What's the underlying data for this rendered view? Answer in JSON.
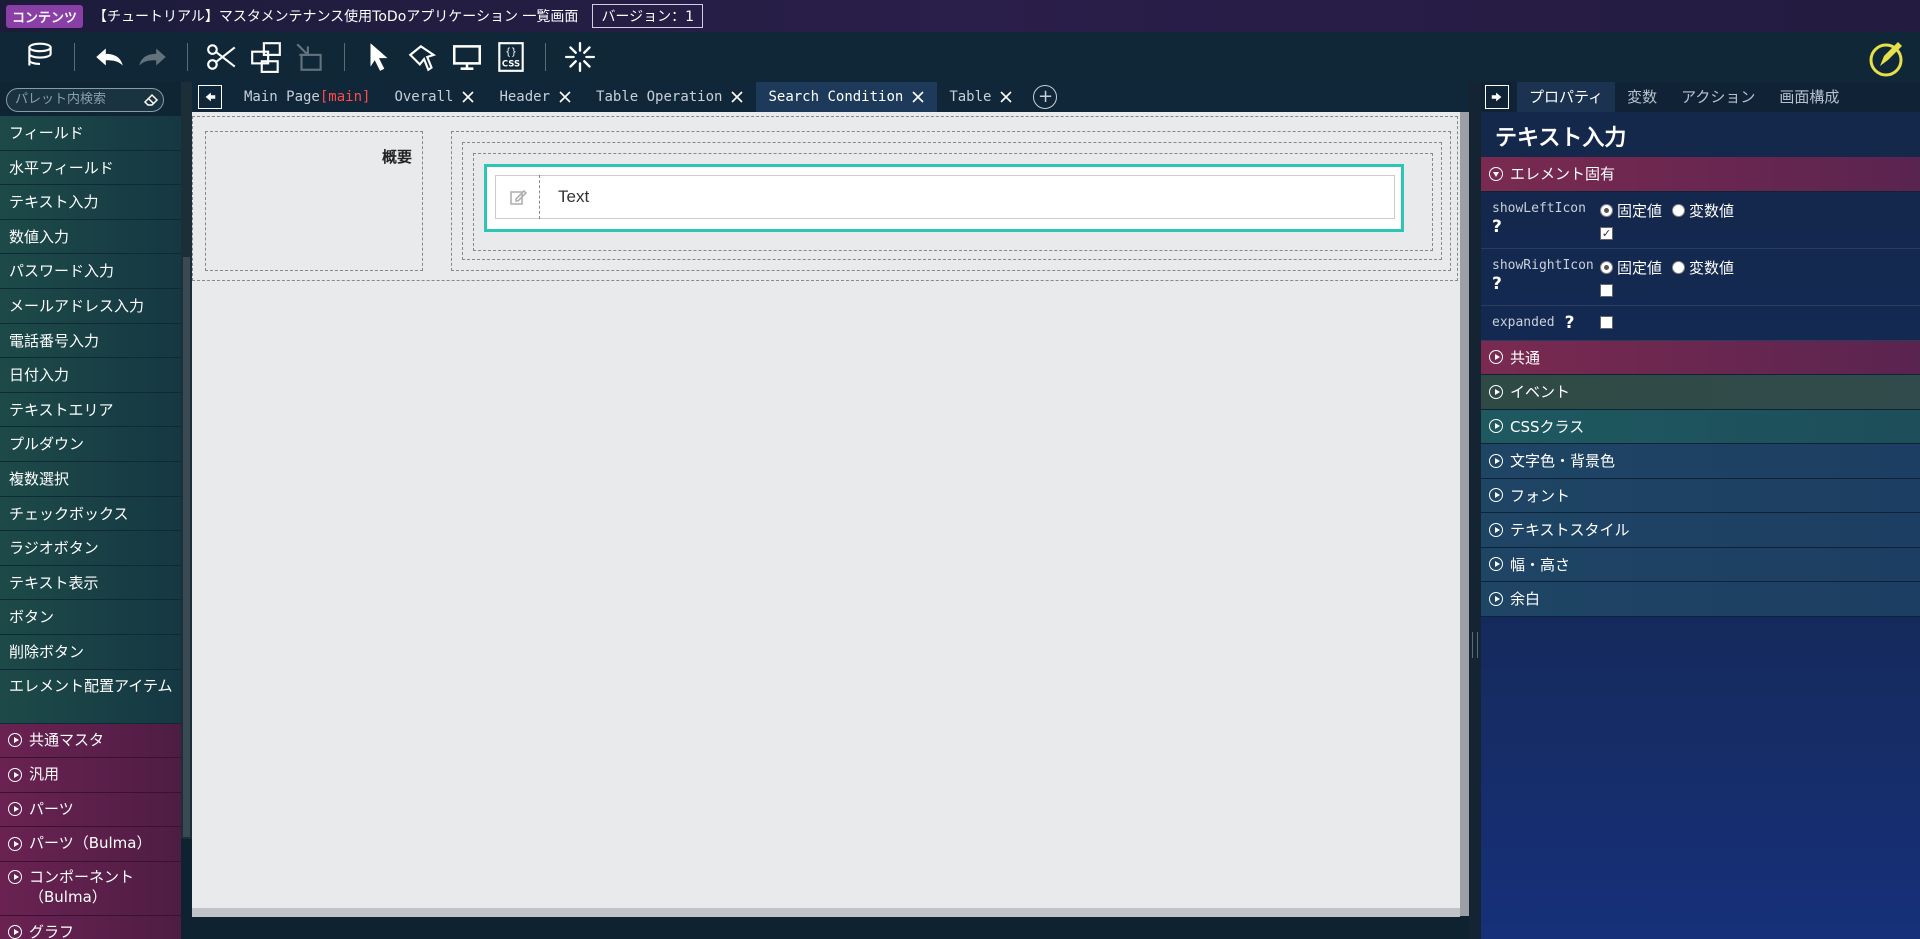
{
  "title": {
    "badge": "コンテンツ",
    "text": "【チュートリアル】マスタメンテナンス使用ToDoアプリケーション 一覧画面",
    "version": "バージョン：1"
  },
  "palette": {
    "search_placeholder": "パレット内検索",
    "items": [
      "フィールド",
      "水平フィールド",
      "テキスト入力",
      "数値入力",
      "パスワード入力",
      "メールアドレス入力",
      "電話番号入力",
      "日付入力",
      "テキストエリア",
      "プルダウン",
      "複数選択",
      "チェックボックス",
      "ラジオボタン",
      "テキスト表示",
      "ボタン",
      "削除ボタン",
      "エレメント配置アイテム"
    ],
    "groups": [
      "共通マスタ",
      "汎用",
      "パーツ",
      "パーツ（Bulma）",
      "コンポーネント（Bulma）",
      "グラフ"
    ]
  },
  "tabs": [
    {
      "label": "Main Page",
      "tag": "[main]"
    },
    {
      "label": "Overall"
    },
    {
      "label": "Header"
    },
    {
      "label": "Table Operation"
    },
    {
      "label": "Search Condition",
      "active": true
    },
    {
      "label": "Table"
    }
  ],
  "canvas": {
    "label": "概要",
    "input_value": "Text"
  },
  "panel": {
    "tabs": [
      "プロパティ",
      "変数",
      "アクション",
      "画面構成"
    ],
    "title": "テキスト入力",
    "element_section": "エレメント固有",
    "props": [
      {
        "name": "showLeftIcon",
        "fixed": "固定値",
        "variable": "変数値",
        "checked": true
      },
      {
        "name": "showRightIcon",
        "fixed": "固定値",
        "variable": "変数値",
        "checked": false
      },
      {
        "name": "expanded",
        "checked": false
      }
    ],
    "sections": [
      "共通",
      "イベント",
      "CSSクラス",
      "文字色・背景色",
      "フォント",
      "テキストスタイル",
      "幅・高さ",
      "余白"
    ]
  },
  "colors": {
    "accent": "#2ec4b6",
    "group_pink": "#6a2252",
    "main_tag": "#ff4a4a"
  }
}
